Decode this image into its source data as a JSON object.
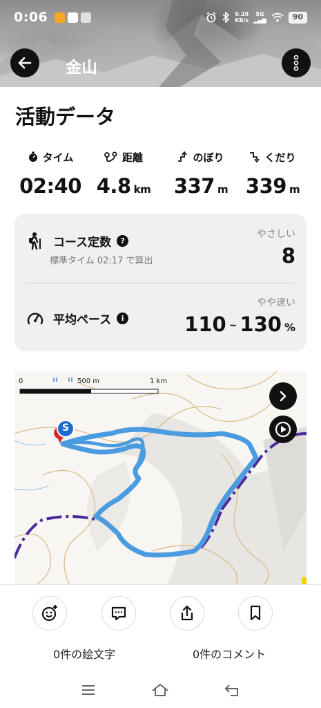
{
  "status_bar": {
    "time": "0:06",
    "speed_value": "0.20",
    "speed_unit": "KB/s",
    "network": "5G",
    "battery": "90"
  },
  "header": {
    "title": "金山"
  },
  "activity": {
    "section_title": "活動データ",
    "stats": [
      {
        "label": "タイム",
        "value": "02:40",
        "unit": ""
      },
      {
        "label": "距離",
        "value": "4.8",
        "unit": "km"
      },
      {
        "label": "のぼり",
        "value": "337",
        "unit": "m"
      },
      {
        "label": "くだり",
        "value": "339",
        "unit": "m"
      }
    ]
  },
  "course_card": {
    "course_title": "コース定数",
    "course_sub": "標準タイム 02:17 で算出",
    "course_rating": "やさしい",
    "course_value": "8",
    "pace_title": "平均ペース",
    "pace_rating": "やや速い",
    "pace_low": "110",
    "pace_sep": "~",
    "pace_high": "130",
    "pace_unit": "%"
  },
  "map": {
    "scale_zero": "0",
    "scale_mid": "500 m",
    "scale_end": "1 km",
    "start_marker": "S"
  },
  "bottom": {
    "emoji_label": "0件の絵文字",
    "comment_label": "0件のコメント"
  }
}
